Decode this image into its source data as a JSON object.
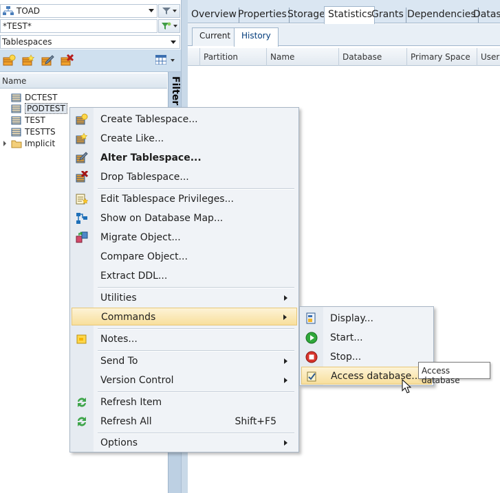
{
  "connection": {
    "name": "TOAD"
  },
  "filter": {
    "value": "*TEST*"
  },
  "object_type": {
    "value": "Tablespaces"
  },
  "tree": {
    "header": "Name",
    "filter_label": "Filter",
    "items": [
      {
        "label": "DCTEST"
      },
      {
        "label": "PODTEST"
      },
      {
        "label": "TEST"
      },
      {
        "label": "TESTTS"
      },
      {
        "label": "Implicit"
      }
    ]
  },
  "tabs": [
    {
      "label": "Overview"
    },
    {
      "label": "Properties"
    },
    {
      "label": "Storage"
    },
    {
      "label": "Statistics"
    },
    {
      "label": "Grants"
    },
    {
      "label": "Dependencies"
    },
    {
      "label": "Datase"
    }
  ],
  "subtabs": [
    {
      "label": "Current"
    },
    {
      "label": "History"
    }
  ],
  "columns": [
    {
      "label": "Partition"
    },
    {
      "label": "Name"
    },
    {
      "label": "Database"
    },
    {
      "label": "Primary Space"
    },
    {
      "label": "User"
    }
  ],
  "context_menu": {
    "create_tablespace": "Create Tablespace...",
    "create_like": "Create Like...",
    "alter_tablespace": "Alter Tablespace...",
    "drop_tablespace": "Drop Tablespace...",
    "edit_privileges": "Edit Tablespace Privileges...",
    "show_map": "Show on Database Map...",
    "migrate": "Migrate Object...",
    "compare": "Compare Object...",
    "extract_ddl": "Extract DDL...",
    "utilities": "Utilities",
    "commands": "Commands",
    "notes": "Notes...",
    "send_to": "Send To",
    "version_control": "Version Control",
    "refresh_item": "Refresh Item",
    "refresh_all": "Refresh All",
    "refresh_all_shortcut": "Shift+F5",
    "options": "Options"
  },
  "commands_submenu": {
    "display": "Display...",
    "start": "Start...",
    "stop": "Stop...",
    "access_database": "Access database..."
  },
  "tooltip": "Access database",
  "colors": {
    "accent": "#dae6f2",
    "highlight": "#f8df9c",
    "start_green": "#2fa83a",
    "stop_red": "#d8342c"
  }
}
